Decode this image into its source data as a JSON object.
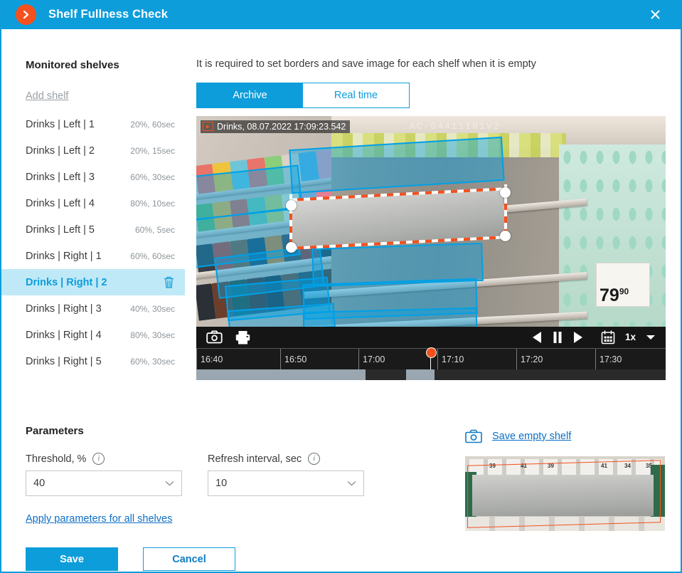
{
  "window": {
    "title": "Shelf Fullness Check",
    "app_icon": "chevron-right-circle-icon",
    "close_label": "✕",
    "accent_color": "#0d9ddb",
    "badge_color": "#f4511e"
  },
  "sidebar": {
    "heading": "Monitored shelves",
    "add_shelf_label": "Add shelf",
    "delete_icon": "trash-icon",
    "shelves": [
      {
        "name": "Drinks  |  Left  |  1",
        "meta": "20%, 60sec",
        "selected": false
      },
      {
        "name": "Drinks  |  Left  |  2",
        "meta": "20%, 15sec",
        "selected": false
      },
      {
        "name": "Drinks  |  Left  |  3",
        "meta": "60%, 30sec",
        "selected": false
      },
      {
        "name": "Drinks  |  Left  |  4",
        "meta": "80%, 10sec",
        "selected": false
      },
      {
        "name": "Drinks  |  Left  |  5",
        "meta": "60%, 5sec",
        "selected": false
      },
      {
        "name": "Drinks  |  Right  |  1",
        "meta": "60%, 60sec",
        "selected": false
      },
      {
        "name": "Drinks  |  Right  |  2",
        "meta": "",
        "selected": true
      },
      {
        "name": "Drinks  |  Right  |  3",
        "meta": "40%, 30sec",
        "selected": false
      },
      {
        "name": "Drinks  |  Right  |  4",
        "meta": "80%, 30sec",
        "selected": false
      },
      {
        "name": "Drinks  |  Right  |  5",
        "meta": "60%, 30sec",
        "selected": false
      }
    ]
  },
  "main": {
    "hint": "It is required to set borders and save image for each shelf when it is empty",
    "tabs": [
      {
        "label": "Archive",
        "active": true
      },
      {
        "label": "Real time",
        "active": false
      }
    ]
  },
  "video": {
    "stamp": "Drinks, 08.07.2022 17:09:23.542",
    "stamp_icon": "play-badge-icon",
    "camera_watermark": "AC-D4411IR1V2",
    "price_tag": {
      "value": "79",
      "cents": "90"
    },
    "controls": {
      "snapshot_icon": "camera-icon",
      "print_icon": "printer-icon",
      "step_back_icon": "play-reverse-icon",
      "pause_icon": "pause-icon",
      "play_icon": "play-icon",
      "calendar_icon": "calendar-icon",
      "speed_label": "1x",
      "speed_chevron_icon": "chevron-down-icon"
    },
    "timeline": {
      "ticks": [
        "16:40",
        "16:50",
        "17:00",
        "17:10",
        "17:20",
        "17:30"
      ],
      "playhead_label": "17:09",
      "playhead_icon": "playhead-dot-icon"
    }
  },
  "parameters": {
    "heading": "Parameters",
    "threshold": {
      "label": "Threshold, %",
      "info_icon": "info-icon",
      "value": "40",
      "chevron_icon": "chevron-down-icon"
    },
    "refresh": {
      "label": "Refresh interval, sec",
      "info_icon": "info-icon",
      "value": "10",
      "chevron_icon": "chevron-down-icon"
    },
    "apply_all_label": "Apply parameters for all shelves"
  },
  "empty_shelf": {
    "camera_icon": "camera-icon",
    "link_label": "Save empty shelf",
    "thumb_tags": [
      "39",
      "41",
      "39",
      "41",
      "34",
      "35"
    ]
  },
  "footer": {
    "save_label": "Save",
    "cancel_label": "Cancel"
  }
}
